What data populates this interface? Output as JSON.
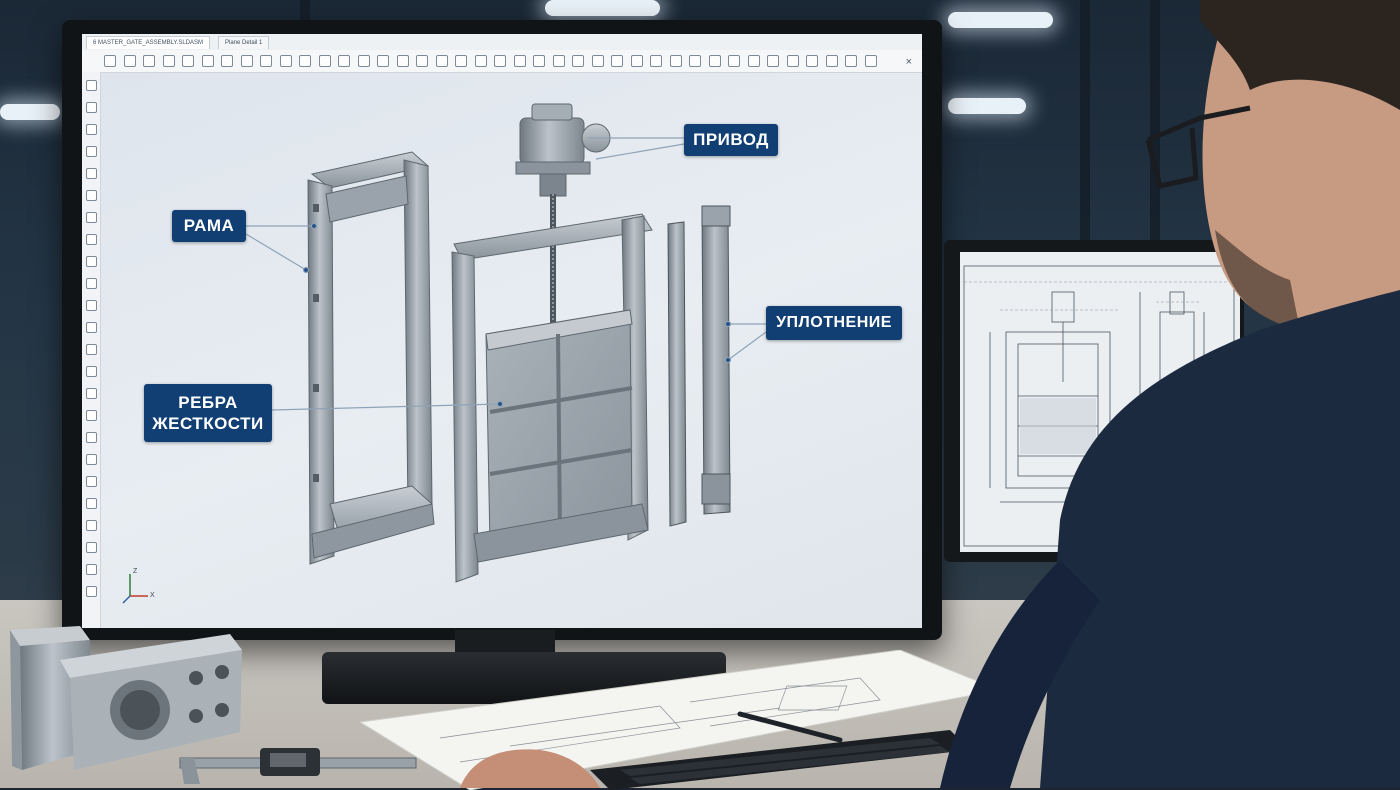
{
  "screen": {
    "tabs": [
      {
        "label": "6 MASTER_GATE_ASSEMBLY.SLDASM"
      },
      {
        "label": "Plane Detail 1"
      }
    ],
    "close_glyph": "×",
    "axes": {
      "z": "Z",
      "x": "X"
    }
  },
  "callouts": {
    "privod": "ПРИВОД",
    "rama": "РАМА",
    "uplotnenie": "УПЛОТНЕНИЕ",
    "rebra_line1": "РЕБРА",
    "rebra_line2": "ЖЕСТКОСТИ"
  },
  "colors": {
    "callout_bg": "#123f73",
    "callout_text": "#ffffff",
    "metal": "#9aa3ab",
    "viewport": "#e3e9ef"
  }
}
